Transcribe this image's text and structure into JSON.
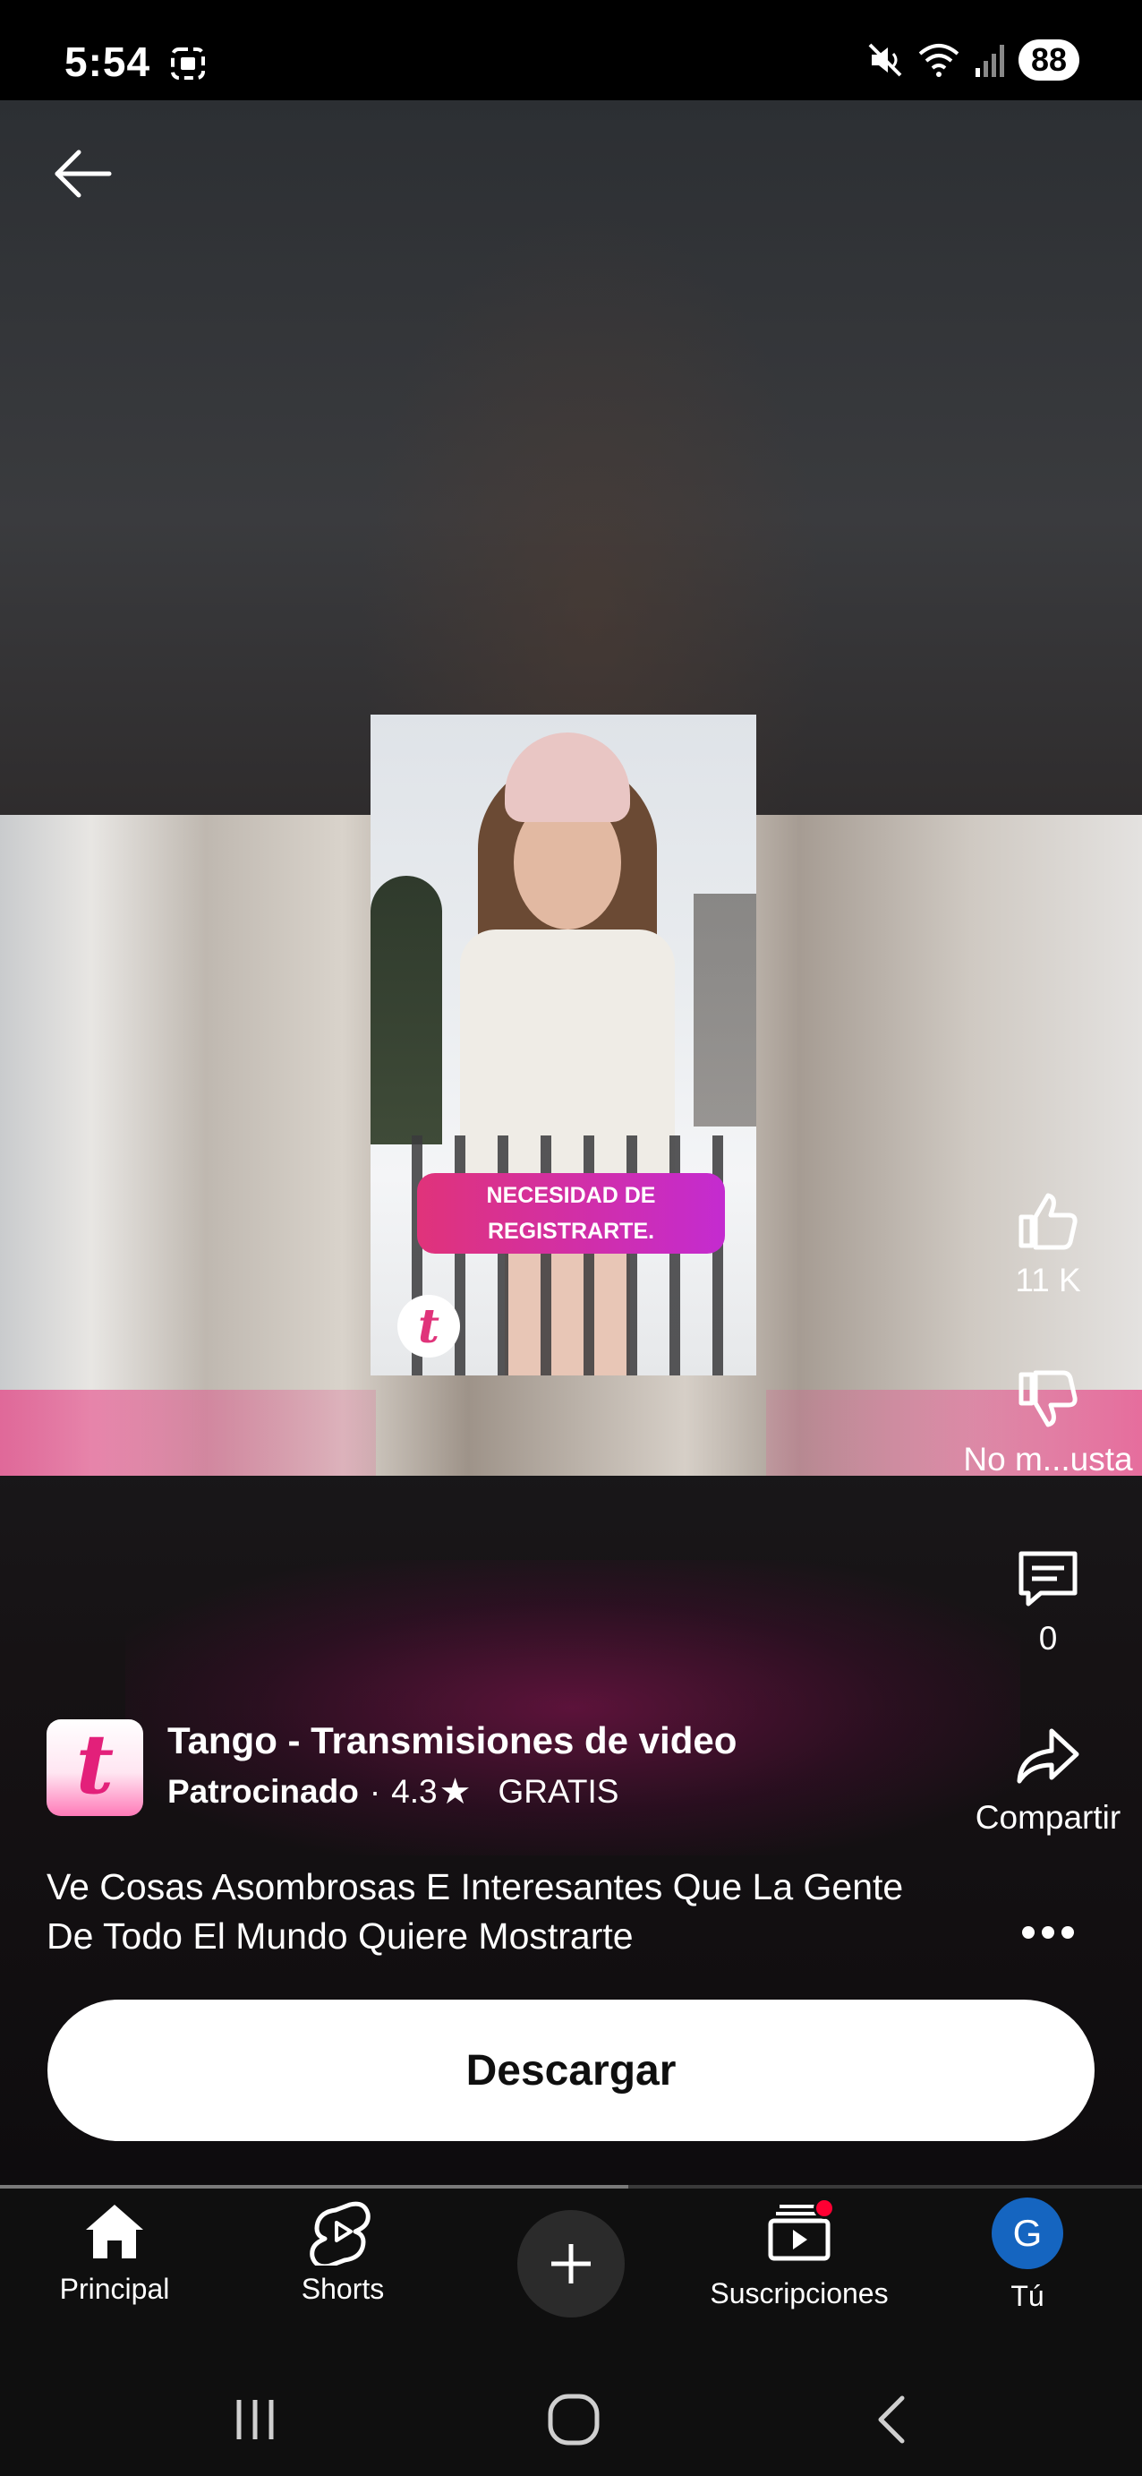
{
  "status_bar": {
    "time": "5:54",
    "battery": "88",
    "icons": [
      "screenshot-icon",
      "mute-icon",
      "wifi-icon",
      "signal-icon"
    ]
  },
  "video": {
    "thumbnail_banner": "NECESIDAD DE REGISTRARTE.",
    "thumbnail_logo": "t"
  },
  "actions": {
    "like_count": "11 K",
    "dislike_label": "No m...usta",
    "comment_count": "0",
    "share_label": "Compartir"
  },
  "ad": {
    "app_icon_letter": "t",
    "title": "Tango - Transmisiones de video",
    "sponsored": "Patrocinado",
    "separator": "·",
    "rating": "4.3",
    "star": "★",
    "price": "GRATIS",
    "description": "Ve Cosas Asombrosas E Interesantes Que La Gente De Todo El Mundo Quiere Mostrarte",
    "cta": "Descargar"
  },
  "progress": {
    "fraction": 0.55
  },
  "bottom_nav": {
    "items": [
      {
        "label": "Principal",
        "icon": "home-icon"
      },
      {
        "label": "Shorts",
        "icon": "shorts-icon"
      },
      {
        "label": "",
        "icon": "create-icon"
      },
      {
        "label": "Suscripciones",
        "icon": "subscriptions-icon"
      },
      {
        "label": "Tú",
        "icon": "avatar"
      }
    ],
    "avatar_letter": "G"
  },
  "colors": {
    "accent_red": "#ff0033",
    "avatar_blue": "#1565c0",
    "brand_pink": "#e3207a"
  }
}
